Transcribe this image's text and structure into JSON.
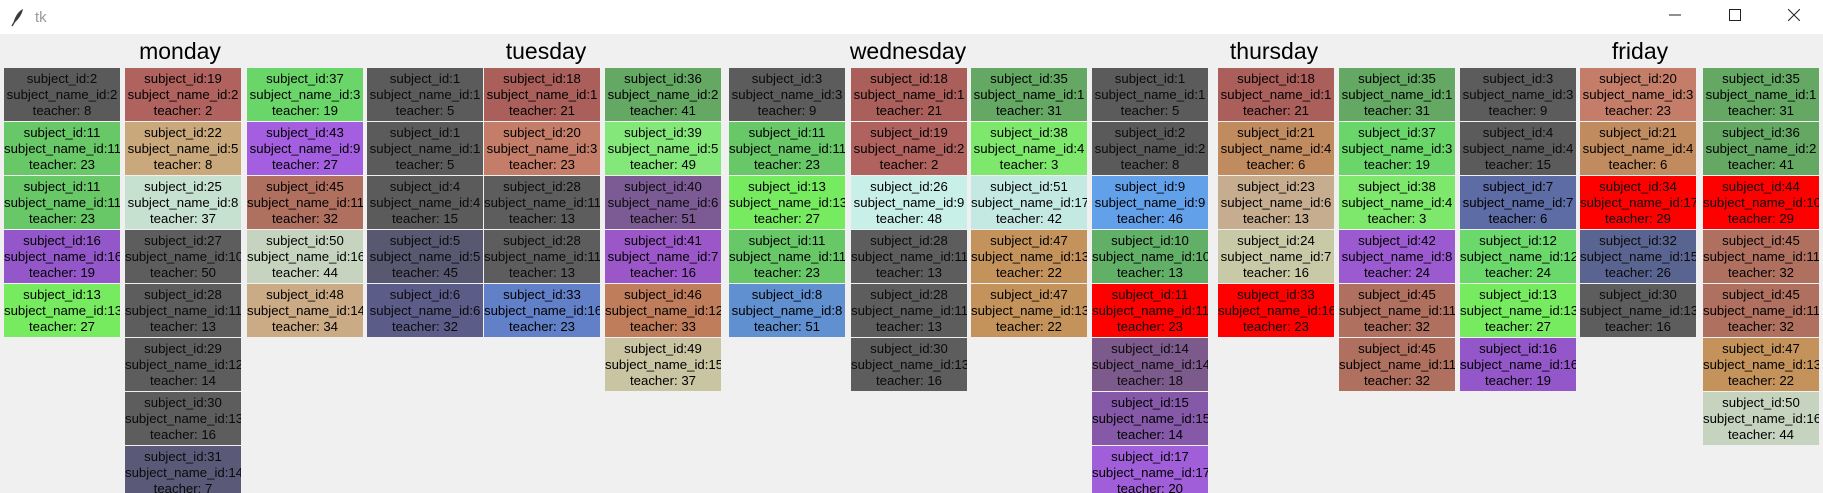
{
  "window": {
    "title": "tk",
    "app_icon": "feather-icon",
    "controls": [
      "minimize-icon",
      "maximize-icon",
      "close-icon"
    ]
  },
  "days": [
    "monday",
    "tuesday",
    "wednesday",
    "thursday",
    "friday"
  ],
  "columns": [
    [
      {
        "subject": "subject_id:2",
        "name": "subject_name_id:2",
        "teacher": "teacher: 8",
        "color": "#5a5a5a"
      },
      {
        "subject": "subject_id:11",
        "name": "subject_name_id:11",
        "teacher": "teacher: 23",
        "color": "#68c868"
      },
      {
        "subject": "subject_id:11",
        "name": "subject_name_id:11",
        "teacher": "teacher: 23",
        "color": "#68c868"
      },
      {
        "subject": "subject_id:16",
        "name": "subject_name_id:16",
        "teacher": "teacher: 19",
        "color": "#9357c9"
      },
      {
        "subject": "subject_id:13",
        "name": "subject_name_id:13",
        "teacher": "teacher: 27",
        "color": "#76eb60"
      }
    ],
    [
      {
        "subject": "subject_id:19",
        "name": "subject_name_id:2",
        "teacher": "teacher: 2",
        "color": "#b0625f"
      },
      {
        "subject": "subject_id:22",
        "name": "subject_name_id:5",
        "teacher": "teacher: 8",
        "color": "#c9a87b"
      },
      {
        "subject": "subject_id:25",
        "name": "subject_name_id:8",
        "teacher": "teacher: 37",
        "color": "#c7e1d1"
      },
      {
        "subject": "subject_id:27",
        "name": "subject_name_id:10",
        "teacher": "teacher: 50",
        "color": "#5d5d5d"
      },
      {
        "subject": "subject_id:28",
        "name": "subject_name_id:11",
        "teacher": "teacher: 13",
        "color": "#5d5d5d"
      },
      {
        "subject": "subject_id:29",
        "name": "subject_name_id:12",
        "teacher": "teacher: 14",
        "color": "#5d5d5d"
      },
      {
        "subject": "subject_id:30",
        "name": "subject_name_id:13",
        "teacher": "teacher: 16",
        "color": "#5d5d5d"
      },
      {
        "subject": "subject_id:31",
        "name": "subject_name_id:14",
        "teacher": "teacher: 7",
        "color": "#5a5a78"
      }
    ],
    [
      {
        "subject": "subject_id:37",
        "name": "subject_name_id:3",
        "teacher": "teacher: 19",
        "color": "#6ad66a"
      },
      {
        "subject": "subject_id:43",
        "name": "subject_name_id:9",
        "teacher": "teacher: 27",
        "color": "#a45ee0"
      },
      {
        "subject": "subject_id:45",
        "name": "subject_name_id:11",
        "teacher": "teacher: 32",
        "color": "#b0705f"
      },
      {
        "subject": "subject_id:50",
        "name": "subject_name_id:16",
        "teacher": "teacher: 44",
        "color": "#c6d4bf"
      },
      {
        "subject": "subject_id:48",
        "name": "subject_name_id:14",
        "teacher": "teacher: 34",
        "color": "#cbab86"
      }
    ],
    [
      {
        "subject": "subject_id:1",
        "name": "subject_name_id:1",
        "teacher": "teacher: 5",
        "color": "#5b5b5b"
      },
      {
        "subject": "subject_id:1",
        "name": "subject_name_id:1",
        "teacher": "teacher: 5",
        "color": "#5b5b5b"
      },
      {
        "subject": "subject_id:4",
        "name": "subject_name_id:4",
        "teacher": "teacher: 15",
        "color": "#5b5b5b"
      },
      {
        "subject": "subject_id:5",
        "name": "subject_name_id:5",
        "teacher": "teacher: 45",
        "color": "#585870"
      },
      {
        "subject": "subject_id:6",
        "name": "subject_name_id:6",
        "teacher": "teacher: 32",
        "color": "#5c5c88"
      }
    ],
    [
      {
        "subject": "subject_id:18",
        "name": "subject_name_id:1",
        "teacher": "teacher: 21",
        "color": "#ab5f5b"
      },
      {
        "subject": "subject_id:20",
        "name": "subject_name_id:3",
        "teacher": "teacher: 23",
        "color": "#c47d68"
      },
      {
        "subject": "subject_id:28",
        "name": "subject_name_id:11",
        "teacher": "teacher: 13",
        "color": "#5d5d5d"
      },
      {
        "subject": "subject_id:28",
        "name": "subject_name_id:11",
        "teacher": "teacher: 13",
        "color": "#5d5d5d"
      },
      {
        "subject": "subject_id:33",
        "name": "subject_name_id:16",
        "teacher": "teacher: 23",
        "color": "#6280c8"
      }
    ],
    [
      {
        "subject": "subject_id:36",
        "name": "subject_name_id:2",
        "teacher": "teacher: 41",
        "color": "#64a864"
      },
      {
        "subject": "subject_id:39",
        "name": "subject_name_id:5",
        "teacher": "teacher: 49",
        "color": "#84e77a"
      },
      {
        "subject": "subject_id:40",
        "name": "subject_name_id:6",
        "teacher": "teacher: 51",
        "color": "#7c5a94"
      },
      {
        "subject": "subject_id:41",
        "name": "subject_name_id:7",
        "teacher": "teacher: 16",
        "color": "#9b57c8"
      },
      {
        "subject": "subject_id:46",
        "name": "subject_name_id:12",
        "teacher": "teacher: 33",
        "color": "#c07d5b"
      },
      {
        "subject": "subject_id:49",
        "name": "subject_name_id:15",
        "teacher": "teacher: 37",
        "color": "#c9c4a2"
      }
    ],
    [
      {
        "subject": "subject_id:3",
        "name": "subject_name_id:3",
        "teacher": "teacher: 9",
        "color": "#5c5c5c"
      },
      {
        "subject": "subject_id:11",
        "name": "subject_name_id:11",
        "teacher": "teacher: 23",
        "color": "#68c868"
      },
      {
        "subject": "subject_id:13",
        "name": "subject_name_id:13",
        "teacher": "teacher: 27",
        "color": "#76eb60"
      },
      {
        "subject": "subject_id:11",
        "name": "subject_name_id:11",
        "teacher": "teacher: 23",
        "color": "#68c868"
      },
      {
        "subject": "subject_id:8",
        "name": "subject_name_id:8",
        "teacher": "teacher: 51",
        "color": "#6190d0"
      }
    ],
    [
      {
        "subject": "subject_id:18",
        "name": "subject_name_id:1",
        "teacher": "teacher: 21",
        "color": "#ab5f5b"
      },
      {
        "subject": "subject_id:19",
        "name": "subject_name_id:2",
        "teacher": "teacher: 2",
        "color": "#b0625f"
      },
      {
        "subject": "subject_id:26",
        "name": "subject_name_id:9",
        "teacher": "teacher: 48",
        "color": "#c9efe9"
      },
      {
        "subject": "subject_id:28",
        "name": "subject_name_id:11",
        "teacher": "teacher: 13",
        "color": "#5d5d5d"
      },
      {
        "subject": "subject_id:28",
        "name": "subject_name_id:11",
        "teacher": "teacher: 13",
        "color": "#5d5d5d"
      },
      {
        "subject": "subject_id:30",
        "name": "subject_name_id:13",
        "teacher": "teacher: 16",
        "color": "#5d5d5d"
      }
    ],
    [
      {
        "subject": "subject_id:35",
        "name": "subject_name_id:1",
        "teacher": "teacher: 31",
        "color": "#64a864"
      },
      {
        "subject": "subject_id:38",
        "name": "subject_name_id:4",
        "teacher": "teacher: 3",
        "color": "#7de86b"
      },
      {
        "subject": "subject_id:51",
        "name": "subject_name_id:17",
        "teacher": "teacher: 42",
        "color": "#c3e9e2"
      },
      {
        "subject": "subject_id:47",
        "name": "subject_name_id:13",
        "teacher": "teacher: 22",
        "color": "#c4935b"
      },
      {
        "subject": "subject_id:47",
        "name": "subject_name_id:13",
        "teacher": "teacher: 22",
        "color": "#c4935b"
      }
    ],
    [
      {
        "subject": "subject_id:1",
        "name": "subject_name_id:1",
        "teacher": "teacher: 5",
        "color": "#5b5b5b"
      },
      {
        "subject": "subject_id:2",
        "name": "subject_name_id:2",
        "teacher": "teacher: 8",
        "color": "#5a5a5a"
      },
      {
        "subject": "subject_id:9",
        "name": "subject_name_id:9",
        "teacher": "teacher: 46",
        "color": "#62a0ea"
      },
      {
        "subject": "subject_id:10",
        "name": "subject_name_id:10",
        "teacher": "teacher: 13",
        "color": "#62b068"
      },
      {
        "subject": "subject_id:11",
        "name": "subject_name_id:11",
        "teacher": "teacher: 23",
        "color": "#ff0000"
      },
      {
        "subject": "subject_id:14",
        "name": "subject_name_id:14",
        "teacher": "teacher: 18",
        "color": "#7d5a8c"
      },
      {
        "subject": "subject_id:15",
        "name": "subject_name_id:15",
        "teacher": "teacher: 14",
        "color": "#8658a8"
      },
      {
        "subject": "subject_id:17",
        "name": "subject_name_id:17",
        "teacher": "teacher: 20",
        "color": "#a05fd8"
      }
    ],
    [
      {
        "subject": "subject_id:18",
        "name": "subject_name_id:1",
        "teacher": "teacher: 21",
        "color": "#ab5f5b"
      },
      {
        "subject": "subject_id:21",
        "name": "subject_name_id:4",
        "teacher": "teacher: 6",
        "color": "#c08b5e"
      },
      {
        "subject": "subject_id:23",
        "name": "subject_name_id:6",
        "teacher": "teacher: 13",
        "color": "#c6ad8f"
      },
      {
        "subject": "subject_id:24",
        "name": "subject_name_id:7",
        "teacher": "teacher: 16",
        "color": "#c8c9a7"
      },
      {
        "subject": "subject_id:33",
        "name": "subject_name_id:16",
        "teacher": "teacher: 23",
        "color": "#ff0000"
      }
    ],
    [
      {
        "subject": "subject_id:35",
        "name": "subject_name_id:1",
        "teacher": "teacher: 31",
        "color": "#64a864"
      },
      {
        "subject": "subject_id:37",
        "name": "subject_name_id:3",
        "teacher": "teacher: 19",
        "color": "#6ad66a"
      },
      {
        "subject": "subject_id:38",
        "name": "subject_name_id:4",
        "teacher": "teacher: 3",
        "color": "#7de86b"
      },
      {
        "subject": "subject_id:42",
        "name": "subject_name_id:8",
        "teacher": "teacher: 24",
        "color": "#9c5ad0"
      },
      {
        "subject": "subject_id:45",
        "name": "subject_name_id:11",
        "teacher": "teacher: 32",
        "color": "#b0705f"
      },
      {
        "subject": "subject_id:45",
        "name": "subject_name_id:11",
        "teacher": "teacher: 32",
        "color": "#b0705f"
      }
    ],
    [
      {
        "subject": "subject_id:3",
        "name": "subject_name_id:3",
        "teacher": "teacher: 9",
        "color": "#5c5c5c"
      },
      {
        "subject": "subject_id:4",
        "name": "subject_name_id:4",
        "teacher": "teacher: 15",
        "color": "#5b5b5b"
      },
      {
        "subject": "subject_id:7",
        "name": "subject_name_id:7",
        "teacher": "teacher: 6",
        "color": "#5d6ca5"
      },
      {
        "subject": "subject_id:12",
        "name": "subject_name_id:12",
        "teacher": "teacher: 24",
        "color": "#6ad86a"
      },
      {
        "subject": "subject_id:13",
        "name": "subject_name_id:13",
        "teacher": "teacher: 27",
        "color": "#76eb60"
      },
      {
        "subject": "subject_id:16",
        "name": "subject_name_id:16",
        "teacher": "teacher: 19",
        "color": "#9357c9"
      }
    ],
    [
      {
        "subject": "subject_id:20",
        "name": "subject_name_id:3",
        "teacher": "teacher: 23",
        "color": "#c47d68"
      },
      {
        "subject": "subject_id:21",
        "name": "subject_name_id:4",
        "teacher": "teacher: 6",
        "color": "#c08b5e"
      },
      {
        "subject": "subject_id:34",
        "name": "subject_name_id:17",
        "teacher": "teacher: 29",
        "color": "#ff0000"
      },
      {
        "subject": "subject_id:32",
        "name": "subject_name_id:15",
        "teacher": "teacher: 26",
        "color": "#5a6490"
      },
      {
        "subject": "subject_id:30",
        "name": "subject_name_id:13",
        "teacher": "teacher: 16",
        "color": "#5d5d5d"
      }
    ],
    [
      {
        "subject": "subject_id:35",
        "name": "subject_name_id:1",
        "teacher": "teacher: 31",
        "color": "#64a864"
      },
      {
        "subject": "subject_id:36",
        "name": "subject_name_id:2",
        "teacher": "teacher: 41",
        "color": "#64a864"
      },
      {
        "subject": "subject_id:44",
        "name": "subject_name_id:10",
        "teacher": "teacher: 29",
        "color": "#ff0000"
      },
      {
        "subject": "subject_id:45",
        "name": "subject_name_id:11",
        "teacher": "teacher: 32",
        "color": "#b0705f"
      },
      {
        "subject": "subject_id:45",
        "name": "subject_name_id:11",
        "teacher": "teacher: 32",
        "color": "#b0705f"
      },
      {
        "subject": "subject_id:47",
        "name": "subject_name_id:13",
        "teacher": "teacher: 22",
        "color": "#c4935b"
      },
      {
        "subject": "subject_id:50",
        "name": "subject_name_id:16",
        "teacher": "teacher: 44",
        "color": "#c6d4bf"
      }
    ]
  ]
}
